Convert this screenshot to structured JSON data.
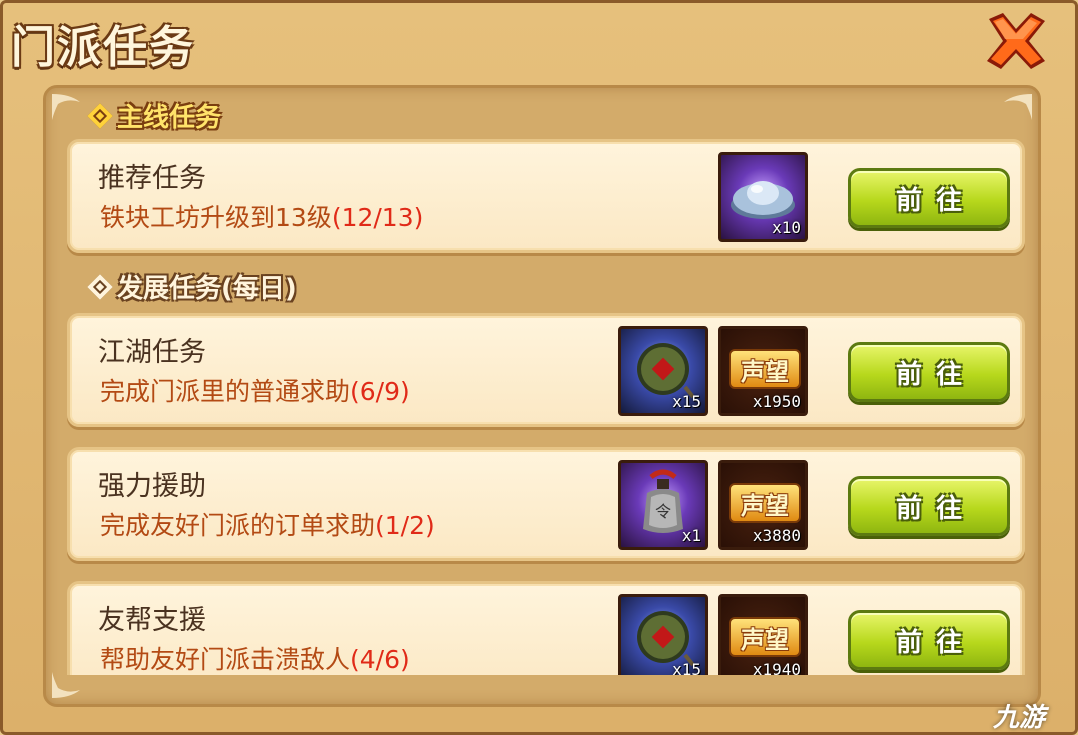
{
  "window": {
    "title": "门派任务"
  },
  "sections": {
    "main": "主线任务",
    "daily": "发展任务(每日)"
  },
  "tasks": [
    {
      "name": "推荐任务",
      "desc": "铁块工坊升级到13级",
      "progress": "(12/13)",
      "rewards": [
        {
          "icon": "silver-ingot-icon",
          "count": "x10"
        }
      ],
      "button": "前往"
    },
    {
      "name": "江湖任务",
      "desc": "完成门派里的普通求助",
      "progress": "(6/9)",
      "rewards": [
        {
          "icon": "jade-coin-icon",
          "count": "x15"
        },
        {
          "icon": "fame-icon",
          "label": "声望",
          "count": "x1950"
        }
      ],
      "button": "前往"
    },
    {
      "name": "强力援助",
      "desc": "完成友好门派的订单求助",
      "progress": "(1/2)",
      "rewards": [
        {
          "icon": "money-pouch-icon",
          "count": "x1"
        },
        {
          "icon": "fame-icon",
          "label": "声望",
          "count": "x3880"
        }
      ],
      "button": "前往"
    },
    {
      "name": "友帮支援",
      "desc": "帮助友好门派击溃敌人",
      "progress": "(4/6)",
      "rewards": [
        {
          "icon": "jade-coin-icon",
          "count": "x15"
        },
        {
          "icon": "fame-icon",
          "label": "声望",
          "count": "x1940"
        }
      ],
      "button": "前往"
    }
  ],
  "watermark": "九游",
  "colors": {
    "frame": "#e6c07c",
    "card": "#fff4dc",
    "button": "#b7d81c",
    "progress": "#e02a18",
    "desc": "#b34a14"
  }
}
